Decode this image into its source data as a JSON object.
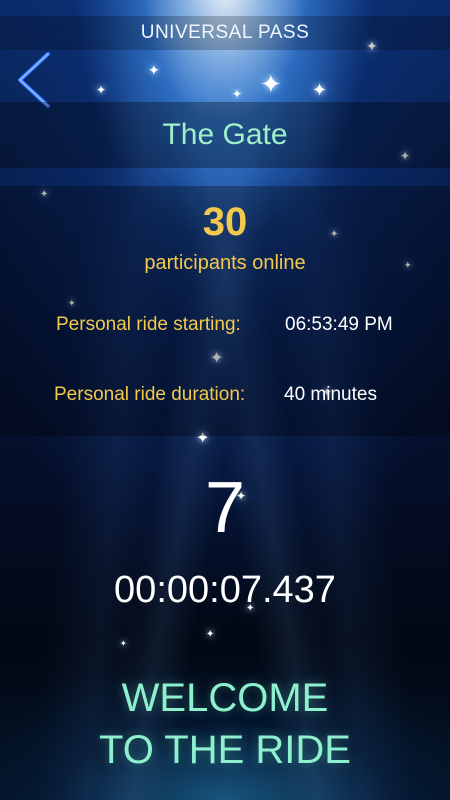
{
  "header": {
    "title": "UNIVERSAL PASS",
    "back_icon": "chevron-left-icon"
  },
  "ride": {
    "name": "The Gate",
    "participants_count": "30",
    "participants_label": "participants online",
    "start_label": "Personal ride starting:",
    "start_value": "06:53:49 PM",
    "duration_label": "Personal ride duration:",
    "duration_value": "40 minutes"
  },
  "countdown": {
    "seconds": "7",
    "elapsed": "00:00:07.437"
  },
  "welcome": {
    "line1": "WELCOME",
    "line2": "TO THE RIDE"
  },
  "colors": {
    "accent_green": "#9ef0c8",
    "accent_gold": "#f2c94c",
    "back_arrow": "#3a7bff"
  }
}
